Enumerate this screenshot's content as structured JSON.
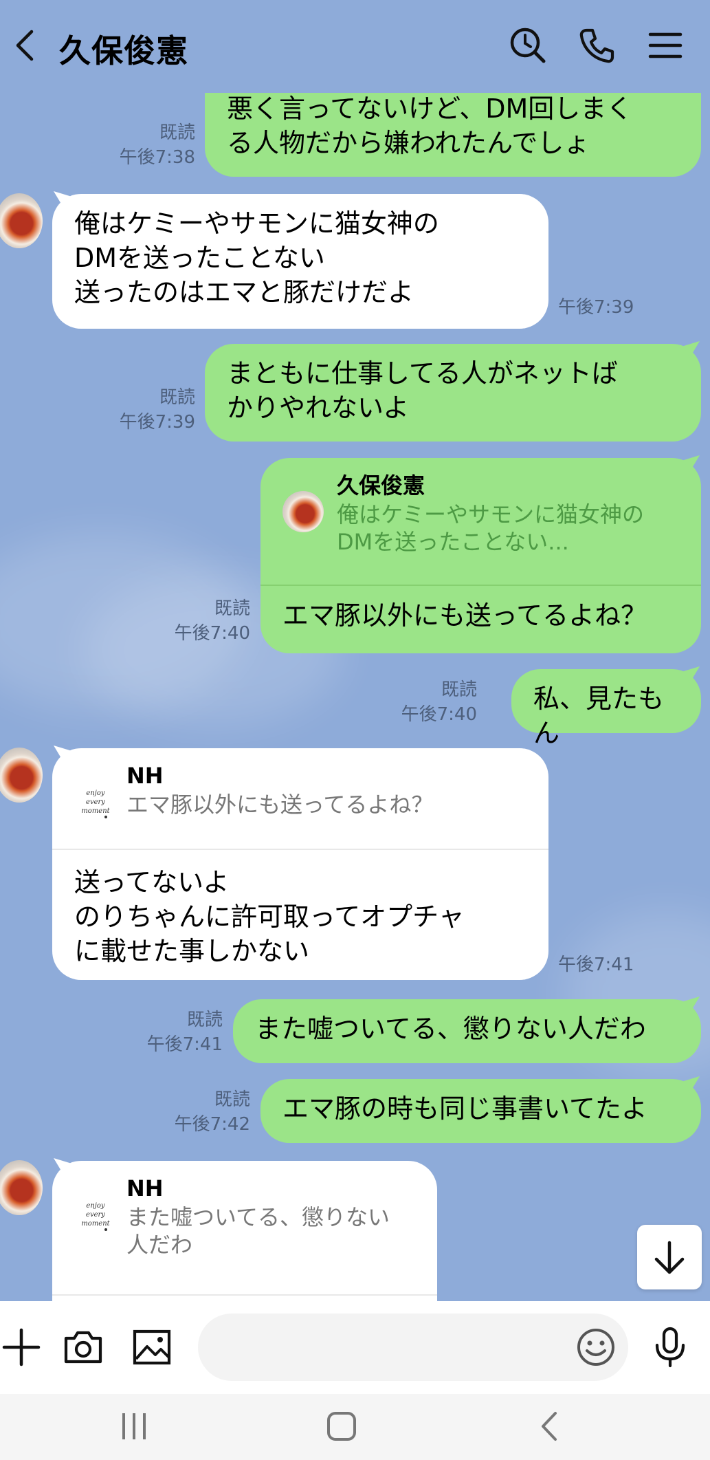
{
  "header": {
    "title": "久保俊憲"
  },
  "messages": [
    {
      "id": "m1",
      "direction": "out",
      "lines": [
        "悪く言ってないけど、DM回しまく",
        "る人物だから嫌われたんでしょ"
      ],
      "read": "既読",
      "time": "午後7:38"
    },
    {
      "id": "m2",
      "direction": "in",
      "lines": [
        "俺はケミーやサモンに猫女神の",
        "DMを送ったことない",
        "送ったのはエマと豚だけだよ"
      ],
      "time": "午後7:39"
    },
    {
      "id": "m3",
      "direction": "out",
      "lines": [
        "まともに仕事してる人がネットば",
        "かりやれないよ"
      ],
      "read": "既読",
      "time": "午後7:39"
    },
    {
      "id": "m4",
      "direction": "out",
      "reply": {
        "name": "久保俊憲",
        "lines": [
          "俺はケミーやサモンに猫女神の",
          "DMを送ったことない..."
        ]
      },
      "lines": [
        "エマ豚以外にも送ってるよね？"
      ],
      "read": "既読",
      "time": "午後7:40"
    },
    {
      "id": "m5",
      "direction": "out",
      "lines": [
        "私、見たもん"
      ],
      "read": "既読",
      "time": "午後7:40"
    },
    {
      "id": "m6",
      "direction": "in",
      "reply": {
        "name": "NH",
        "lines": [
          "エマ豚以外にも送ってるよね？"
        ]
      },
      "lines": [
        "送ってないよ",
        "のりちゃんに許可取ってオプチャ",
        "に載せた事しかない"
      ],
      "time": "午後7:41"
    },
    {
      "id": "m7",
      "direction": "out",
      "lines": [
        "また嘘ついてる、懲りない人だわ"
      ],
      "read": "既読",
      "time": "午後7:41"
    },
    {
      "id": "m8",
      "direction": "out",
      "lines": [
        "エマ豚の時も同じ事書いてたよ"
      ],
      "read": "既読",
      "time": "午後7:42"
    },
    {
      "id": "m9",
      "direction": "in",
      "reply": {
        "name": "NH",
        "lines": [
          "また嘘ついてる、懲りない",
          "人だわ"
        ]
      },
      "lines": []
    }
  ],
  "icons": {
    "header": [
      "back-icon",
      "search-history-icon",
      "phone-icon",
      "menu-icon"
    ],
    "input": [
      "plus-icon",
      "camera-icon",
      "image-icon",
      "emoji-icon",
      "microphone-icon"
    ],
    "nav": [
      "recent-apps-icon",
      "home-icon",
      "nav-back-icon"
    ],
    "jump": "arrow-down-icon"
  },
  "colors": {
    "background": "#8eabd9",
    "outgoing_bubble": "#9be488",
    "incoming_bubble": "#ffffff",
    "meta_text": "#4d5f7c"
  }
}
